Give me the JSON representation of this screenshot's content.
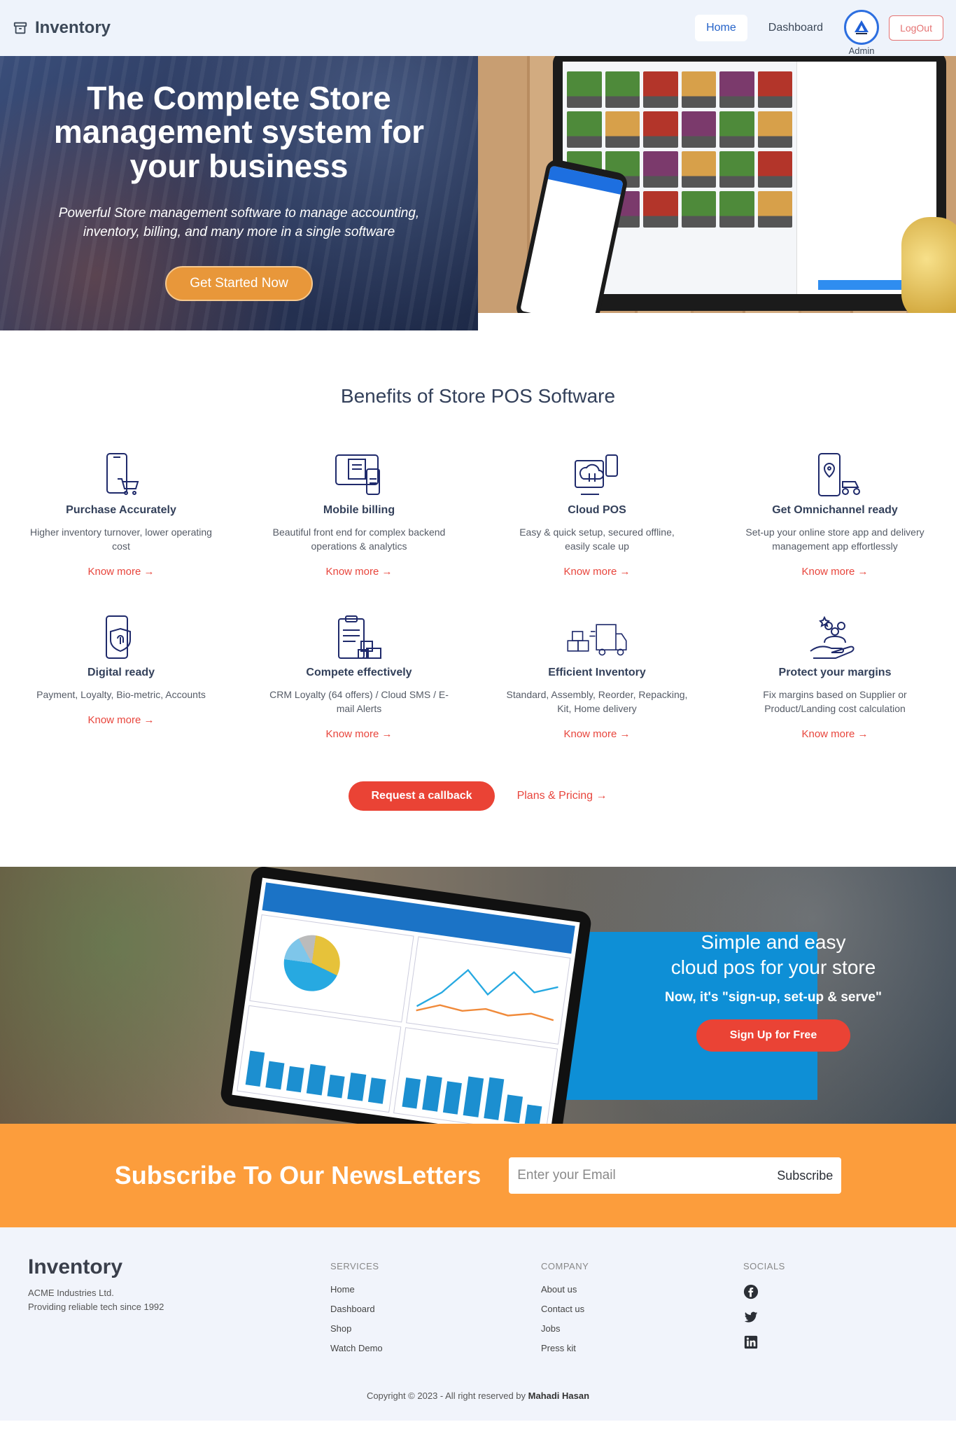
{
  "navbar": {
    "brand": "Inventory",
    "links": [
      "Home",
      "Dashboard"
    ],
    "admin_label": "Admin",
    "logout_label": "LogOut"
  },
  "hero": {
    "title": "The Complete Store management system for your business",
    "subtitle": "Powerful Store management software to manage accounting, inventory, billing, and many more in a single software",
    "cta": "Get Started Now"
  },
  "benefits": {
    "title": "Benefits of Store POS Software",
    "know_more": "Know more",
    "items": [
      {
        "title": "Purchase Accurately",
        "desc": "Higher inventory turnover, lower operating cost",
        "icon": "phone-cart-icon"
      },
      {
        "title": "Mobile billing",
        "desc": "Beautiful front end for complex backend operations & analytics",
        "icon": "tablet-billing-icon"
      },
      {
        "title": "Cloud POS",
        "desc": "Easy & quick setup, secured offline, easily scale up",
        "icon": "cloud-pos-icon"
      },
      {
        "title": "Get Omnichannel ready",
        "desc": "Set-up your online store app and delivery management app effortlessly",
        "icon": "omnichannel-icon"
      },
      {
        "title": "Digital ready",
        "desc": "Payment, Loyalty, Bio-metric, Accounts",
        "icon": "fingerprint-phone-icon"
      },
      {
        "title": "Compete effectively",
        "desc": "CRM Loyalty (64 offers) / Cloud SMS / E-mail Alerts",
        "icon": "clipboard-boxes-icon"
      },
      {
        "title": "Efficient Inventory",
        "desc": "Standard, Assembly, Reorder, Repacking, Kit, Home delivery",
        "icon": "delivery-truck-icon"
      },
      {
        "title": "Protect your margins",
        "desc": "Fix margins based on Supplier or Product/Landing cost calculation",
        "icon": "hand-people-icon"
      }
    ],
    "callback_label": "Request a callback",
    "plans_label": "Plans & Pricing"
  },
  "cloud": {
    "title_line1": "Simple and easy",
    "title_line2": "cloud pos for your store",
    "subtitle": "Now, it's \"sign-up, set-up & serve\"",
    "signup_label": "Sign Up for Free"
  },
  "newsletter": {
    "title": "Subscribe To Our NewsLetters",
    "placeholder": "Enter your Email",
    "button": "Subscribe"
  },
  "footer": {
    "brand": "Inventory",
    "company_name": "ACME Industries Ltd.",
    "tagline": "Providing reliable tech since 1992",
    "services": {
      "title": "SERVICES",
      "links": [
        "Home",
        "Dashboard",
        "Shop",
        "Watch Demo"
      ]
    },
    "company": {
      "title": "COMPANY",
      "links": [
        "About us",
        "Contact us",
        "Jobs",
        "Press kit"
      ]
    },
    "socials": {
      "title": "SOCIALS",
      "icons": [
        "facebook-icon",
        "twitter-icon",
        "linkedin-icon"
      ]
    },
    "copyright": "Copyright © 2023 - All right reserved by",
    "author": "Mahadi Hasan"
  },
  "colors": {
    "primary_blue": "#2563c9",
    "accent_orange": "#fc9d3c",
    "cta_red": "#ea4335",
    "dark_text": "#33405a"
  }
}
